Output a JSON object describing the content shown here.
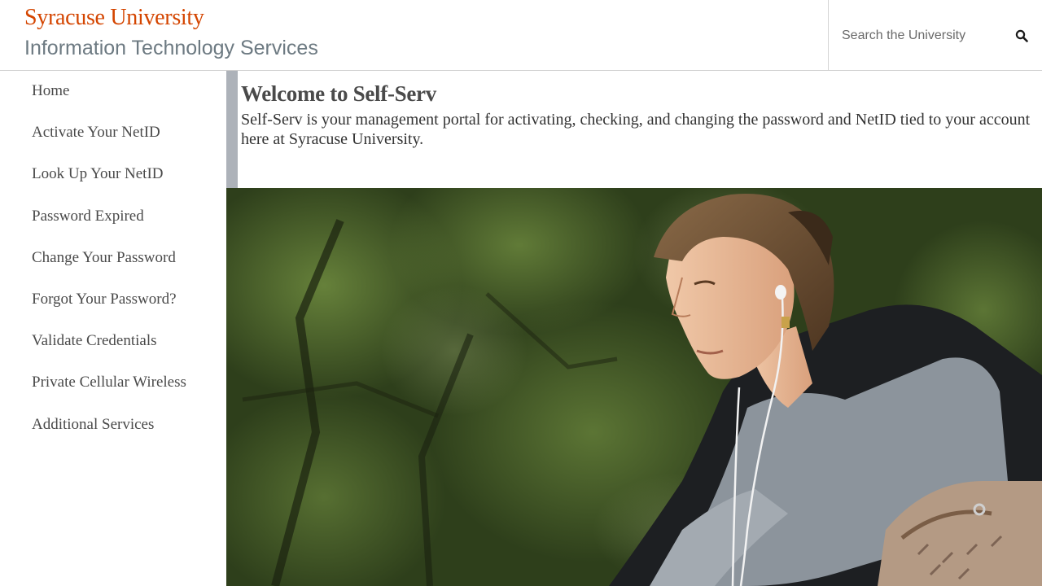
{
  "header": {
    "university": "Syracuse University",
    "department": "Information Technology Services",
    "search": {
      "placeholder": "Search the University",
      "icon": "search-icon"
    }
  },
  "colors": {
    "brand_orange": "#d44500",
    "department_gray": "#6d7a82",
    "nav_text": "#4a4a4a",
    "welcome_bar": "#adb2b9"
  },
  "sidebar": {
    "items": [
      {
        "label": "Home"
      },
      {
        "label": "Activate Your NetID"
      },
      {
        "label": "Look Up Your NetID"
      },
      {
        "label": "Password Expired"
      },
      {
        "label": "Change Your Password"
      },
      {
        "label": "Forgot Your Password?"
      },
      {
        "label": "Validate Credentials"
      },
      {
        "label": "Private Cellular Wireless"
      },
      {
        "label": "Additional Services"
      }
    ]
  },
  "main": {
    "title": "Welcome to Self-Serv",
    "description": "Self-Serv is your management portal for activating, checking, and changing the password and NetID tied to your account here at Syracuse University."
  }
}
